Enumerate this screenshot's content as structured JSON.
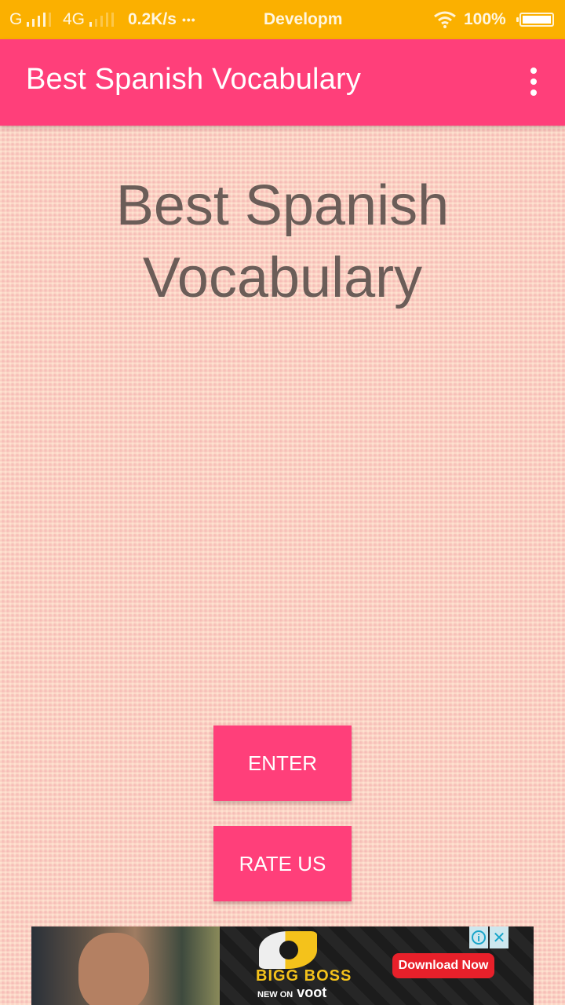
{
  "status_bar": {
    "network1": "G",
    "network2": "4G",
    "speed": "0.2K/s",
    "more": "•••",
    "notification": "Developm",
    "battery_text": "100%",
    "battery_level": 1.0,
    "icons": [
      "signal-icon",
      "signal-icon",
      "wifi-icon",
      "battery-icon"
    ]
  },
  "app_bar": {
    "title": "Best Spanish Vocabulary",
    "menu_icon": "overflow-menu-icon"
  },
  "main": {
    "headline_line1": "Best Spanish",
    "headline_line2": "Vocabulary",
    "buttons": {
      "enter": "ENTER",
      "rate_us": "RATE US"
    }
  },
  "ad": {
    "brand": "BIGG BOSS",
    "tagline_prefix": "NEW ON",
    "tagline_brand": "voot",
    "cta": "Download Now",
    "info_icon": "i",
    "close_icon": "✕"
  },
  "colors": {
    "status_bar": "#fbb000",
    "accent": "#ff3f7a",
    "headline_text": "#6b5d58"
  }
}
